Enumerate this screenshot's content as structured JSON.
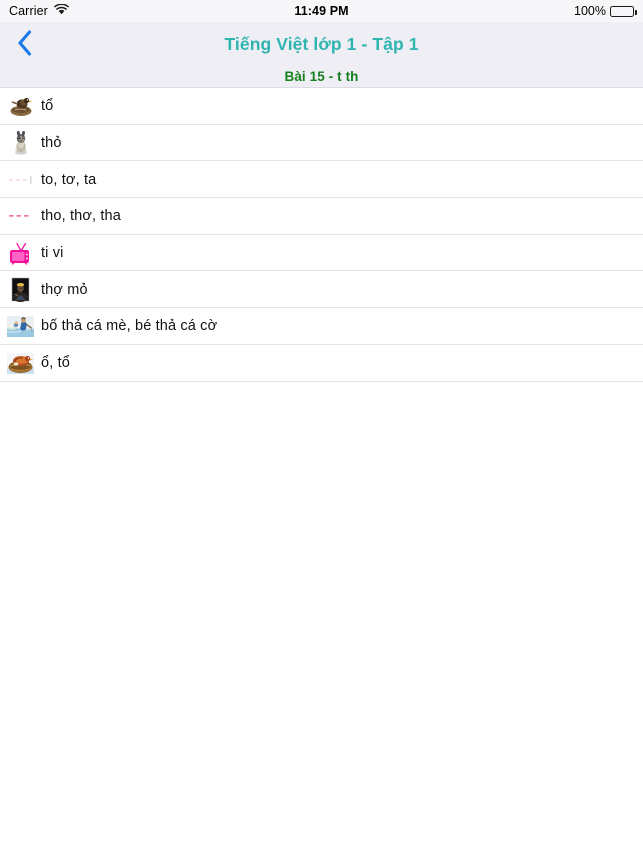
{
  "status_bar": {
    "carrier": "Carrier",
    "wifi_icon": "wifi-icon",
    "time": "11:49 PM",
    "battery_percent": "100%",
    "battery_icon": "battery-full-icon"
  },
  "nav_bar": {
    "back_icon": "chevron-left-icon",
    "title": "Tiếng Việt lớp 1 - Tập 1",
    "title_color": "#2fb5b0"
  },
  "subtitle": {
    "text": "Bài 15 - t th",
    "color": "#15801f"
  },
  "list": {
    "rows": [
      {
        "label": "tổ",
        "icon": "bird-nest-photo-icon"
      },
      {
        "label": "thỏ",
        "icon": "rabbit-photo-icon"
      },
      {
        "label": "to, tơ, ta",
        "icon": "faint-dots-icon"
      },
      {
        "label": "tho, thơ, tha",
        "icon": "pink-dots-icon"
      },
      {
        "label": "ti vi",
        "icon": "television-icon"
      },
      {
        "label": "thợ mỏ",
        "icon": "miner-photo-icon"
      },
      {
        "label": "bố thả cá mè, bé thả cá cờ",
        "icon": "fishing-scene-photo-icon"
      },
      {
        "label": "ổ, tổ",
        "icon": "nest-eggs-photo-icon"
      }
    ]
  },
  "colors": {
    "nav_background": "#efeef4",
    "accent_blue": "#1a7aeb",
    "separator": "#e4e4e6",
    "tv_pink": "#f5119b"
  }
}
